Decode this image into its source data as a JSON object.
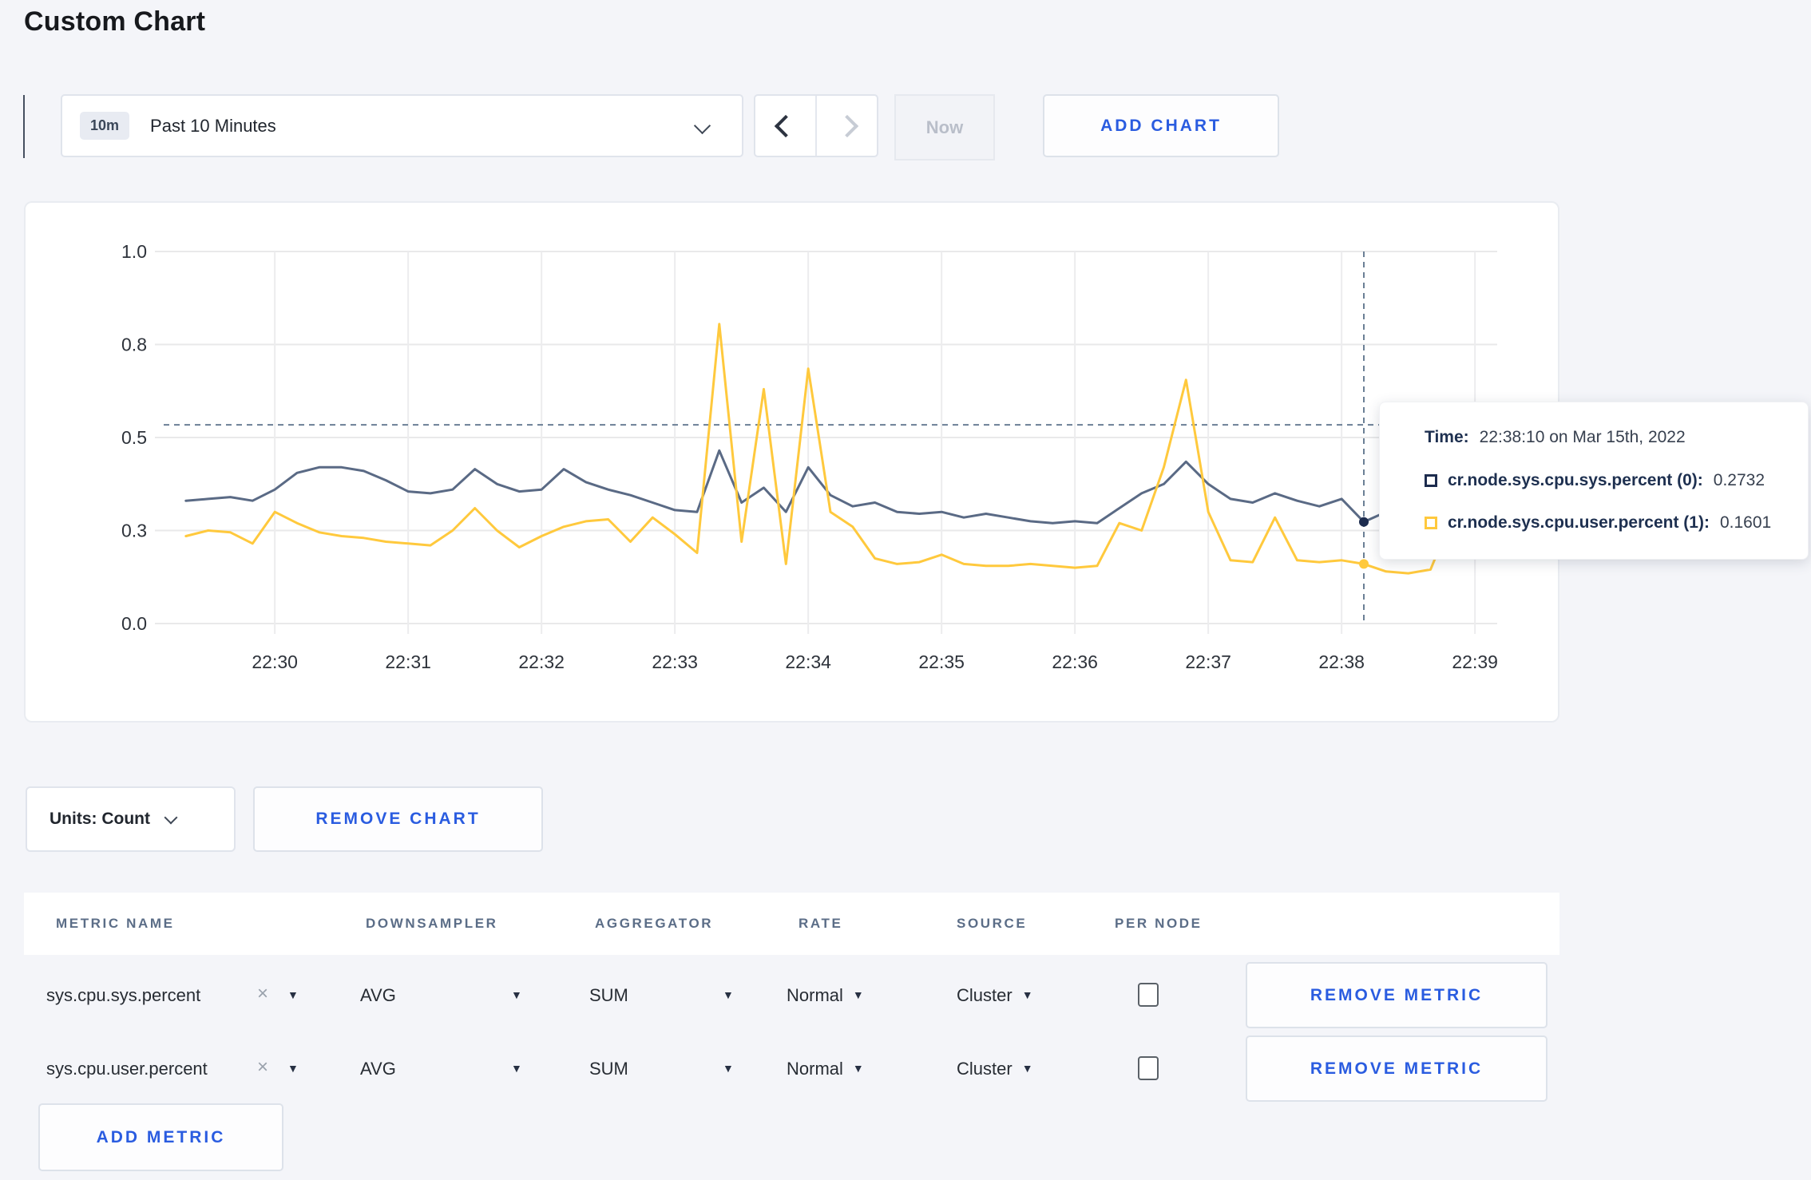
{
  "page": {
    "title": "Custom Chart"
  },
  "icons": {
    "caret_down": "▼",
    "clear": "×"
  },
  "toolbar": {
    "range_badge": "10m",
    "range_label": "Past 10 Minutes",
    "now_label": "Now",
    "add_chart_label": "ADD CHART"
  },
  "chart_actions": {
    "units_label": "Units: Count",
    "remove_chart_label": "REMOVE CHART"
  },
  "tooltip": {
    "time_label": "Time:",
    "time_value": "22:38:10 on Mar 15th, 2022",
    "series": [
      {
        "name": "cr.node.sys.cpu.sys.percent (0):",
        "value": "0.2732",
        "color": "#1d2c4e"
      },
      {
        "name": "cr.node.sys.cpu.user.percent (1):",
        "value": "0.1601",
        "color": "#ffc93d"
      }
    ]
  },
  "metrics_table": {
    "headers": [
      "METRIC NAME",
      "DOWNSAMPLER",
      "AGGREGATOR",
      "RATE",
      "SOURCE",
      "PER NODE"
    ],
    "rows": [
      {
        "metric": "sys.cpu.sys.percent",
        "downsampler": "AVG",
        "aggregator": "SUM",
        "rate": "Normal",
        "source": "Cluster",
        "per_node_checked": false,
        "remove_label": "REMOVE METRIC"
      },
      {
        "metric": "sys.cpu.user.percent",
        "downsampler": "AVG",
        "aggregator": "SUM",
        "rate": "Normal",
        "source": "Cluster",
        "per_node_checked": false,
        "remove_label": "REMOVE METRIC"
      }
    ],
    "add_metric_label": "ADD METRIC"
  },
  "chart_data": {
    "type": "line",
    "title": "",
    "xlabel": "",
    "ylabel": "",
    "grid": true,
    "ylim": [
      0,
      1
    ],
    "x_window": {
      "start": "22:29:10",
      "end": "22:39:10",
      "seconds": 600
    },
    "x_ticks": [
      "22:30",
      "22:31",
      "22:32",
      "22:33",
      "22:34",
      "22:35",
      "22:36",
      "22:37",
      "22:38",
      "22:39"
    ],
    "y_ticks": [
      {
        "label": "0.0",
        "value": 0
      },
      {
        "label": "0.3",
        "value": 0.25
      },
      {
        "label": "0.5",
        "value": 0.5
      },
      {
        "label": "0.8",
        "value": 0.75
      },
      {
        "label": "1.0",
        "value": 1
      }
    ],
    "series": [
      {
        "name": "cr.node.sys.cpu.sys.percent",
        "color": "#5a6a85",
        "start": "22:29:20",
        "interval_seconds": 10,
        "values": [
          0.33,
          0.335,
          0.34,
          0.33,
          0.36,
          0.405,
          0.42,
          0.42,
          0.41,
          0.385,
          0.355,
          0.35,
          0.36,
          0.415,
          0.375,
          0.355,
          0.36,
          0.415,
          0.38,
          0.36,
          0.345,
          0.325,
          0.305,
          0.3,
          0.465,
          0.325,
          0.365,
          0.3,
          0.42,
          0.345,
          0.315,
          0.325,
          0.3,
          0.295,
          0.3,
          0.285,
          0.295,
          0.285,
          0.275,
          0.27,
          0.275,
          0.27,
          0.31,
          0.35,
          0.375,
          0.435,
          0.375,
          0.335,
          0.325,
          0.35,
          0.33,
          0.315,
          0.335,
          0.2732,
          0.3,
          0.31,
          0.3,
          0.295,
          0.3,
          0.305
        ]
      },
      {
        "name": "cr.node.sys.cpu.user.percent",
        "color": "#ffc93d",
        "start": "22:29:20",
        "interval_seconds": 10,
        "values": [
          0.235,
          0.25,
          0.245,
          0.215,
          0.3,
          0.27,
          0.245,
          0.235,
          0.23,
          0.22,
          0.215,
          0.21,
          0.25,
          0.31,
          0.25,
          0.205,
          0.235,
          0.26,
          0.275,
          0.28,
          0.22,
          0.285,
          0.24,
          0.19,
          0.805,
          0.22,
          0.63,
          0.16,
          0.685,
          0.3,
          0.26,
          0.175,
          0.16,
          0.165,
          0.185,
          0.16,
          0.155,
          0.155,
          0.16,
          0.155,
          0.15,
          0.155,
          0.27,
          0.25,
          0.42,
          0.655,
          0.3,
          0.17,
          0.165,
          0.285,
          0.17,
          0.165,
          0.17,
          0.1601,
          0.14,
          0.135,
          0.145,
          0.29,
          0.22,
          0.275
        ]
      }
    ],
    "crosshair": {
      "time": "22:38:10",
      "seconds_from_window_start": 540,
      "hline_value": 0.534,
      "points": [
        {
          "series": 0,
          "value": 0.2732
        },
        {
          "series": 1,
          "value": 0.1601
        }
      ]
    }
  }
}
